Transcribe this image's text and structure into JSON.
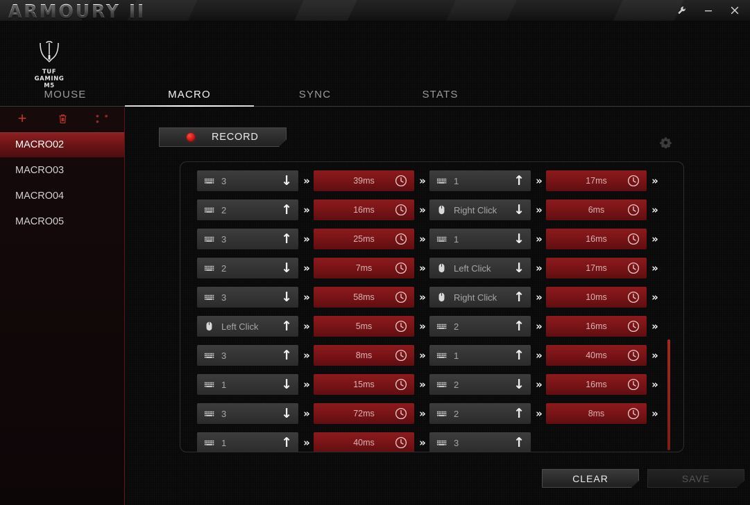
{
  "window": {
    "title": "ARMOURY II",
    "controls": [
      {
        "name": "wrench-icon",
        "label": "⚒"
      },
      {
        "name": "minimize-icon",
        "label": "—"
      },
      {
        "name": "close-icon",
        "label": "✕"
      }
    ]
  },
  "device": {
    "brand": "TUF GAMING",
    "model": "M5",
    "icon": "mouse-icon"
  },
  "tabs": [
    {
      "id": "mouse",
      "label": "MOUSE",
      "active": false
    },
    {
      "id": "macro",
      "label": "MACRO",
      "active": true
    },
    {
      "id": "sync",
      "label": "SYNC",
      "active": false
    },
    {
      "id": "stats",
      "label": "STATS",
      "active": false
    }
  ],
  "sidebar": {
    "tools": [
      {
        "name": "add-macro-button",
        "icon": "plus-icon",
        "label": "+"
      },
      {
        "name": "delete-macro-button",
        "icon": "trash-icon",
        "label": ""
      },
      {
        "name": "more-options-button",
        "icon": "ellipsis-icon",
        "label": "• • •"
      }
    ],
    "items": [
      {
        "label": "MACRO02",
        "selected": true
      },
      {
        "label": "MACRO03",
        "selected": false
      },
      {
        "label": "MACRO04",
        "selected": false
      },
      {
        "label": "MACRO05",
        "selected": false
      }
    ]
  },
  "toolbar": {
    "record_label": "RECORD",
    "record_icon": "record-dot-icon",
    "settings_icon": "gear-icon"
  },
  "sequence": {
    "separator": "»",
    "delay_icon": "clock-icon",
    "key_icon": "keyboard-icon",
    "mouse_icon": "mouse-button-icon",
    "rows": [
      {
        "left": {
          "icon": "keyboard-icon",
          "label": "3",
          "dir": "down"
        },
        "delay1": "39ms",
        "right": {
          "icon": "keyboard-icon",
          "label": "1",
          "dir": "up"
        },
        "delay2": "17ms"
      },
      {
        "left": {
          "icon": "keyboard-icon",
          "label": "2",
          "dir": "up"
        },
        "delay1": "16ms",
        "right": {
          "icon": "mouse-button-icon",
          "label": "Right Click",
          "dir": "down"
        },
        "delay2": "6ms"
      },
      {
        "left": {
          "icon": "keyboard-icon",
          "label": "3",
          "dir": "up"
        },
        "delay1": "25ms",
        "right": {
          "icon": "keyboard-icon",
          "label": "1",
          "dir": "down"
        },
        "delay2": "16ms"
      },
      {
        "left": {
          "icon": "keyboard-icon",
          "label": "2",
          "dir": "down"
        },
        "delay1": "7ms",
        "right": {
          "icon": "mouse-button-icon",
          "label": "Left Click",
          "dir": "down"
        },
        "delay2": "17ms"
      },
      {
        "left": {
          "icon": "keyboard-icon",
          "label": "3",
          "dir": "down"
        },
        "delay1": "58ms",
        "right": {
          "icon": "mouse-button-icon",
          "label": "Right Click",
          "dir": "up"
        },
        "delay2": "10ms"
      },
      {
        "left": {
          "icon": "mouse-button-icon",
          "label": "Left Click",
          "dir": "up"
        },
        "delay1": "5ms",
        "right": {
          "icon": "keyboard-icon",
          "label": "2",
          "dir": "up"
        },
        "delay2": "16ms"
      },
      {
        "left": {
          "icon": "keyboard-icon",
          "label": "3",
          "dir": "up"
        },
        "delay1": "8ms",
        "right": {
          "icon": "keyboard-icon",
          "label": "1",
          "dir": "up"
        },
        "delay2": "40ms"
      },
      {
        "left": {
          "icon": "keyboard-icon",
          "label": "1",
          "dir": "down"
        },
        "delay1": "15ms",
        "right": {
          "icon": "keyboard-icon",
          "label": "2",
          "dir": "down"
        },
        "delay2": "16ms"
      },
      {
        "left": {
          "icon": "keyboard-icon",
          "label": "3",
          "dir": "down"
        },
        "delay1": "72ms",
        "right": {
          "icon": "keyboard-icon",
          "label": "2",
          "dir": "up"
        },
        "delay2": "8ms"
      },
      {
        "left": {
          "icon": "keyboard-icon",
          "label": "1",
          "dir": "up"
        },
        "delay1": "40ms",
        "right": {
          "icon": "keyboard-icon",
          "label": "3",
          "dir": "up"
        },
        "delay2": null
      }
    ]
  },
  "footer": {
    "clear_label": "CLEAR",
    "save_label": "SAVE",
    "save_enabled": false
  },
  "colors": {
    "accent_red": "#8c1a1d",
    "selected_red": "#8e1f21",
    "scrollbar_red": "#a02a22",
    "chip_gray": "#3d3d3d"
  }
}
